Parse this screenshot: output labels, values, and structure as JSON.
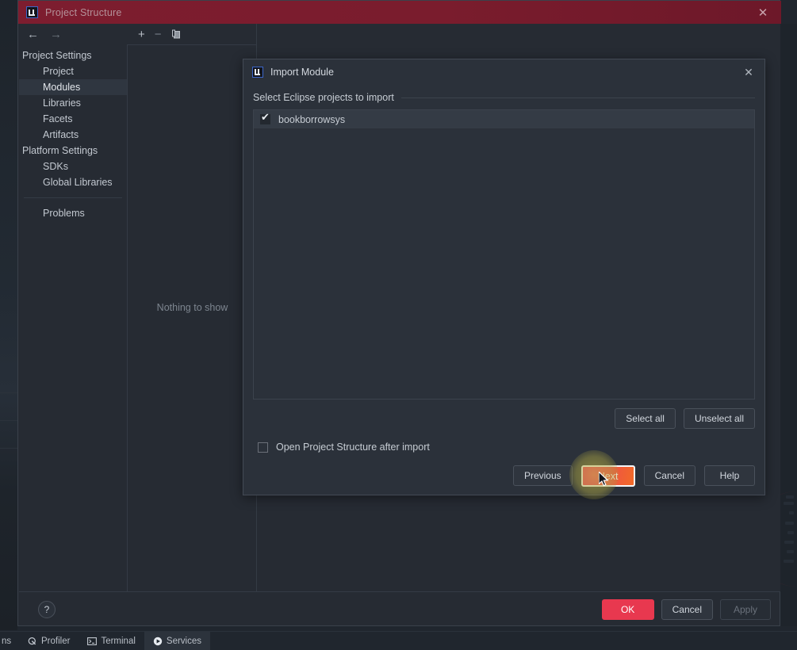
{
  "window": {
    "title": "Project Structure",
    "icon": "intellij-idea-icon",
    "close_label": "✕",
    "nav_back": "←",
    "nav_forward": "→"
  },
  "sidebar": {
    "groups": [
      {
        "label": "Project Settings",
        "type": "group"
      },
      {
        "label": "Project",
        "type": "item",
        "selected": false
      },
      {
        "label": "Modules",
        "type": "item",
        "selected": true
      },
      {
        "label": "Libraries",
        "type": "item",
        "selected": false
      },
      {
        "label": "Facets",
        "type": "item",
        "selected": false
      },
      {
        "label": "Artifacts",
        "type": "item",
        "selected": false
      },
      {
        "label": "Platform Settings",
        "type": "group"
      },
      {
        "label": "SDKs",
        "type": "item",
        "selected": false
      },
      {
        "label": "Global Libraries",
        "type": "item",
        "selected": false
      },
      {
        "label": "Problems",
        "type": "item",
        "selected": false,
        "after_separator": true
      }
    ]
  },
  "module_panel": {
    "toolbar": {
      "add": "+",
      "remove": "−",
      "copy": "copy-icon"
    },
    "empty_text": "Nothing to show"
  },
  "window_footer": {
    "help": "?",
    "ok": "OK",
    "cancel": "Cancel",
    "apply": "Apply"
  },
  "import_dialog": {
    "title": "Import Module",
    "icon": "intellij-idea-icon",
    "close_label": "✕",
    "section_label": "Select Eclipse projects to import",
    "projects": [
      {
        "name": "bookborrowsys",
        "checked": true
      }
    ],
    "select_all": "Select all",
    "unselect_all": "Unselect all",
    "open_structure_option": {
      "label": "Open Project Structure after import",
      "checked": false
    },
    "buttons": {
      "previous": "Previous",
      "next": "Next",
      "cancel": "Cancel",
      "help": "Help"
    }
  },
  "statusbar": {
    "items": [
      {
        "label": "ns",
        "icon": "",
        "active": false
      },
      {
        "label": "Profiler",
        "icon": "profiler-icon",
        "active": false
      },
      {
        "label": "Terminal",
        "icon": "terminal-icon",
        "active": false
      },
      {
        "label": "Services",
        "icon": "services-icon",
        "active": true
      }
    ]
  },
  "colors": {
    "titlebar_red": "#7a1c2d",
    "primary_red": "#e8384f",
    "next_gradient_start": "#e8335a",
    "next_gradient_end": "#f26a27",
    "click_glow": "#c4ba48",
    "panel_bg": "#262b33",
    "dialog_bg": "#2b313a"
  }
}
